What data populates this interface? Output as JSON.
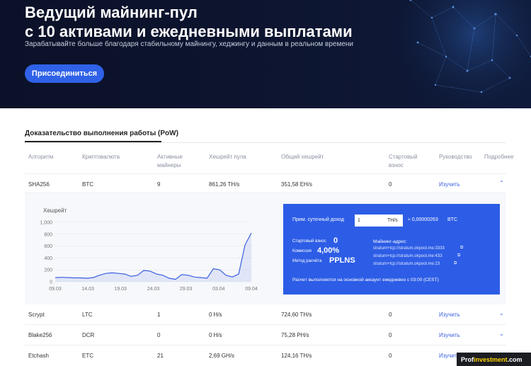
{
  "hero": {
    "title_line1": "Ведущий майнинг-пул",
    "title_line2": "с 10 активами и ежедневными выплатами",
    "subtitle": "Зарабатывайте больше благодаря стабильному майнингу, хеджингу и данным в реальном времени",
    "join_label": "Присоединиться"
  },
  "section": {
    "tab_label": "Доказательство выполнения работы (PoW)"
  },
  "table": {
    "headers": {
      "algorithm": "Алгоритм",
      "crypto": "Криптовалюта",
      "active1": "Активные",
      "active2": "майнеры",
      "pool_hash": "Хешрейт пула",
      "total_hash": "Общий хешрейт",
      "start1": "Стартовый",
      "start2": "взнос",
      "guide": "Руководство",
      "more": "Подробнее"
    },
    "rows": [
      {
        "algo": "SHA256",
        "coin": "BTC",
        "miners": "9",
        "pool": "861,26 TH/s",
        "total": "351,58 EH/s",
        "fee": "0",
        "guide": "Изучить",
        "chevron": "⌃"
      },
      {
        "algo": "Scrypt",
        "coin": "LTC",
        "miners": "1",
        "pool": "0 H/s",
        "total": "724,60 TH/s",
        "fee": "0",
        "guide": "Изучить",
        "chevron": "⌄"
      },
      {
        "algo": "Blake256",
        "coin": "DCR",
        "miners": "0",
        "pool": "0 H/s",
        "total": "75,28 PH/s",
        "fee": "0",
        "guide": "Изучить",
        "chevron": "⌄"
      },
      {
        "algo": "Etchash",
        "coin": "ETC",
        "miners": "21",
        "pool": "2,69 GH/s",
        "total": "124,16 TH/s",
        "fee": "0",
        "guide": "Изучить",
        "chevron": "⌄"
      }
    ]
  },
  "calculator": {
    "income_label": "Прим. суточный доход",
    "input_value": "1",
    "unit": "TH/s",
    "result": "≈ 0,00000263",
    "currency": "BTC",
    "start_fee_label": "Стартовый взнос",
    "start_fee_value": "0",
    "commission_label": "Комиссия",
    "commission_value": "4,00%",
    "method_label": "Метод расчёта",
    "method_value": "PPLNS",
    "address_label": "Майнинг-адрес:",
    "addresses": [
      "stratum+tcp://stratum.okpool.me:3333",
      "stratum+tcp://stratum.okpool.me:433",
      "stratum+tcp://stratum.okpool.me:23"
    ],
    "note": "Расчет выполняется на основной аккаунт ежедневно с 03:00 (CEST)"
  },
  "chart_data": {
    "type": "area",
    "title": "Хешрейт",
    "x_ticks": [
      "09.03",
      "14.03",
      "19.03",
      "24.03",
      "29.03",
      "03.04",
      "09.04"
    ],
    "y_ticks": [
      "0",
      "200",
      "400",
      "600",
      "800",
      "1,000"
    ],
    "ylim": [
      0,
      1000
    ],
    "x": [
      0,
      1,
      2,
      3,
      4,
      5,
      6,
      7,
      8,
      9,
      10,
      11,
      12,
      13,
      14,
      15,
      16,
      17,
      18,
      19,
      20,
      21,
      22,
      23,
      24,
      25,
      26,
      27,
      28,
      29,
      30,
      31
    ],
    "values": [
      70,
      75,
      70,
      65,
      65,
      60,
      70,
      110,
      140,
      150,
      140,
      130,
      90,
      110,
      190,
      180,
      130,
      110,
      60,
      40,
      120,
      110,
      80,
      70,
      60,
      220,
      200,
      110,
      80,
      130,
      620,
      820
    ],
    "color": "#3a5fe0",
    "grid": true
  },
  "watermark": {
    "prefix": "Prof",
    "accent": "investment",
    "suffix": ".com"
  }
}
